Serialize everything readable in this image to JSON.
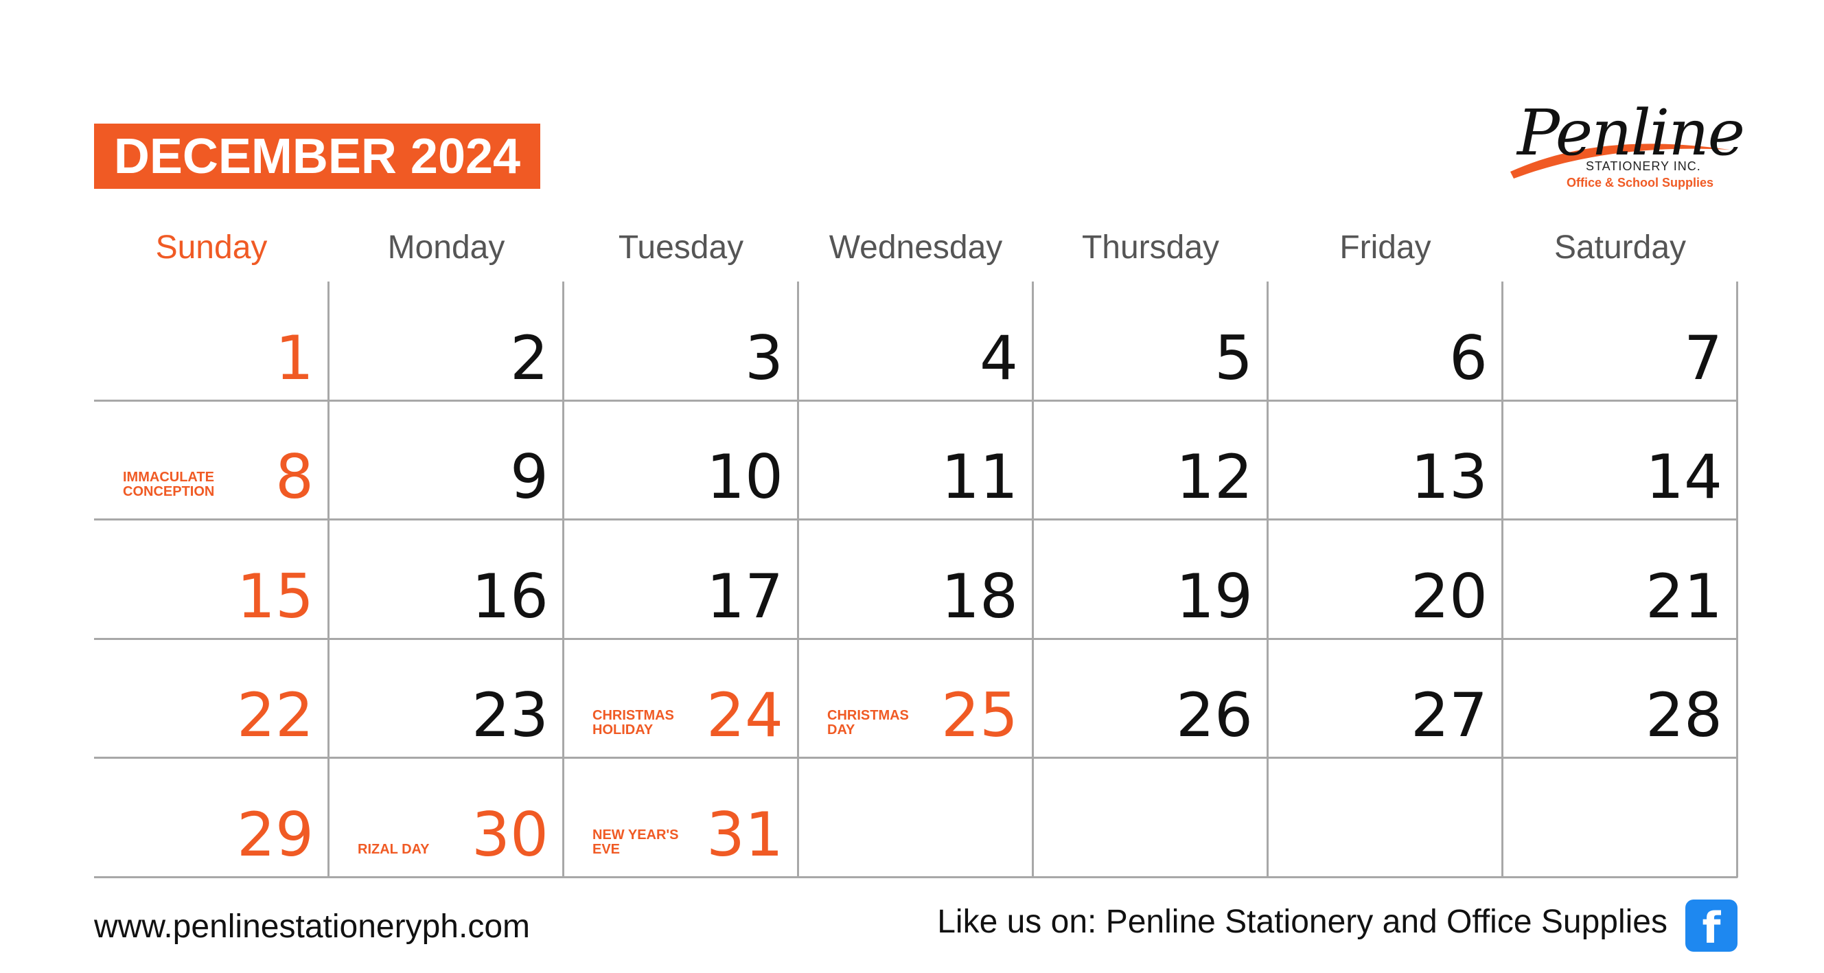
{
  "header": {
    "title": "DECEMBER 2024",
    "accent_color": "#f05a24"
  },
  "logo": {
    "script_text": "Penline",
    "line1": "STATIONERY INC.",
    "line2": "Office & School Supplies"
  },
  "weekdays": [
    "Sunday",
    "Monday",
    "Tuesday",
    "Wednesday",
    "Thursday",
    "Friday",
    "Saturday"
  ],
  "weeks": [
    [
      {
        "d": "1"
      },
      {
        "d": "2"
      },
      {
        "d": "3"
      },
      {
        "d": "4"
      },
      {
        "d": "5"
      },
      {
        "d": "6"
      },
      {
        "d": "7"
      }
    ],
    [
      {
        "d": "8",
        "note": "IMMACULATE\nCONCEPTION"
      },
      {
        "d": "9"
      },
      {
        "d": "10"
      },
      {
        "d": "11"
      },
      {
        "d": "12"
      },
      {
        "d": "13"
      },
      {
        "d": "14"
      }
    ],
    [
      {
        "d": "15"
      },
      {
        "d": "16"
      },
      {
        "d": "17"
      },
      {
        "d": "18"
      },
      {
        "d": "19"
      },
      {
        "d": "20"
      },
      {
        "d": "21"
      }
    ],
    [
      {
        "d": "22"
      },
      {
        "d": "23"
      },
      {
        "d": "24",
        "note": "CHRISTMAS\nHOLIDAY"
      },
      {
        "d": "25",
        "note": "CHRISTMAS\nDAY"
      },
      {
        "d": "26"
      },
      {
        "d": "27"
      },
      {
        "d": "28"
      }
    ],
    [
      {
        "d": "29"
      },
      {
        "d": "30",
        "note": "RIZAL DAY"
      },
      {
        "d": "31",
        "note": "NEW YEAR'S\nEVE"
      },
      {
        "d": ""
      },
      {
        "d": ""
      },
      {
        "d": ""
      },
      {
        "d": ""
      }
    ]
  ],
  "footer": {
    "website": "www.penlinestationeryph.com",
    "like_text": "Like us on: Penline Stationery and Office Supplies",
    "fb_icon": "facebook-icon",
    "fb_glyph": "f"
  }
}
